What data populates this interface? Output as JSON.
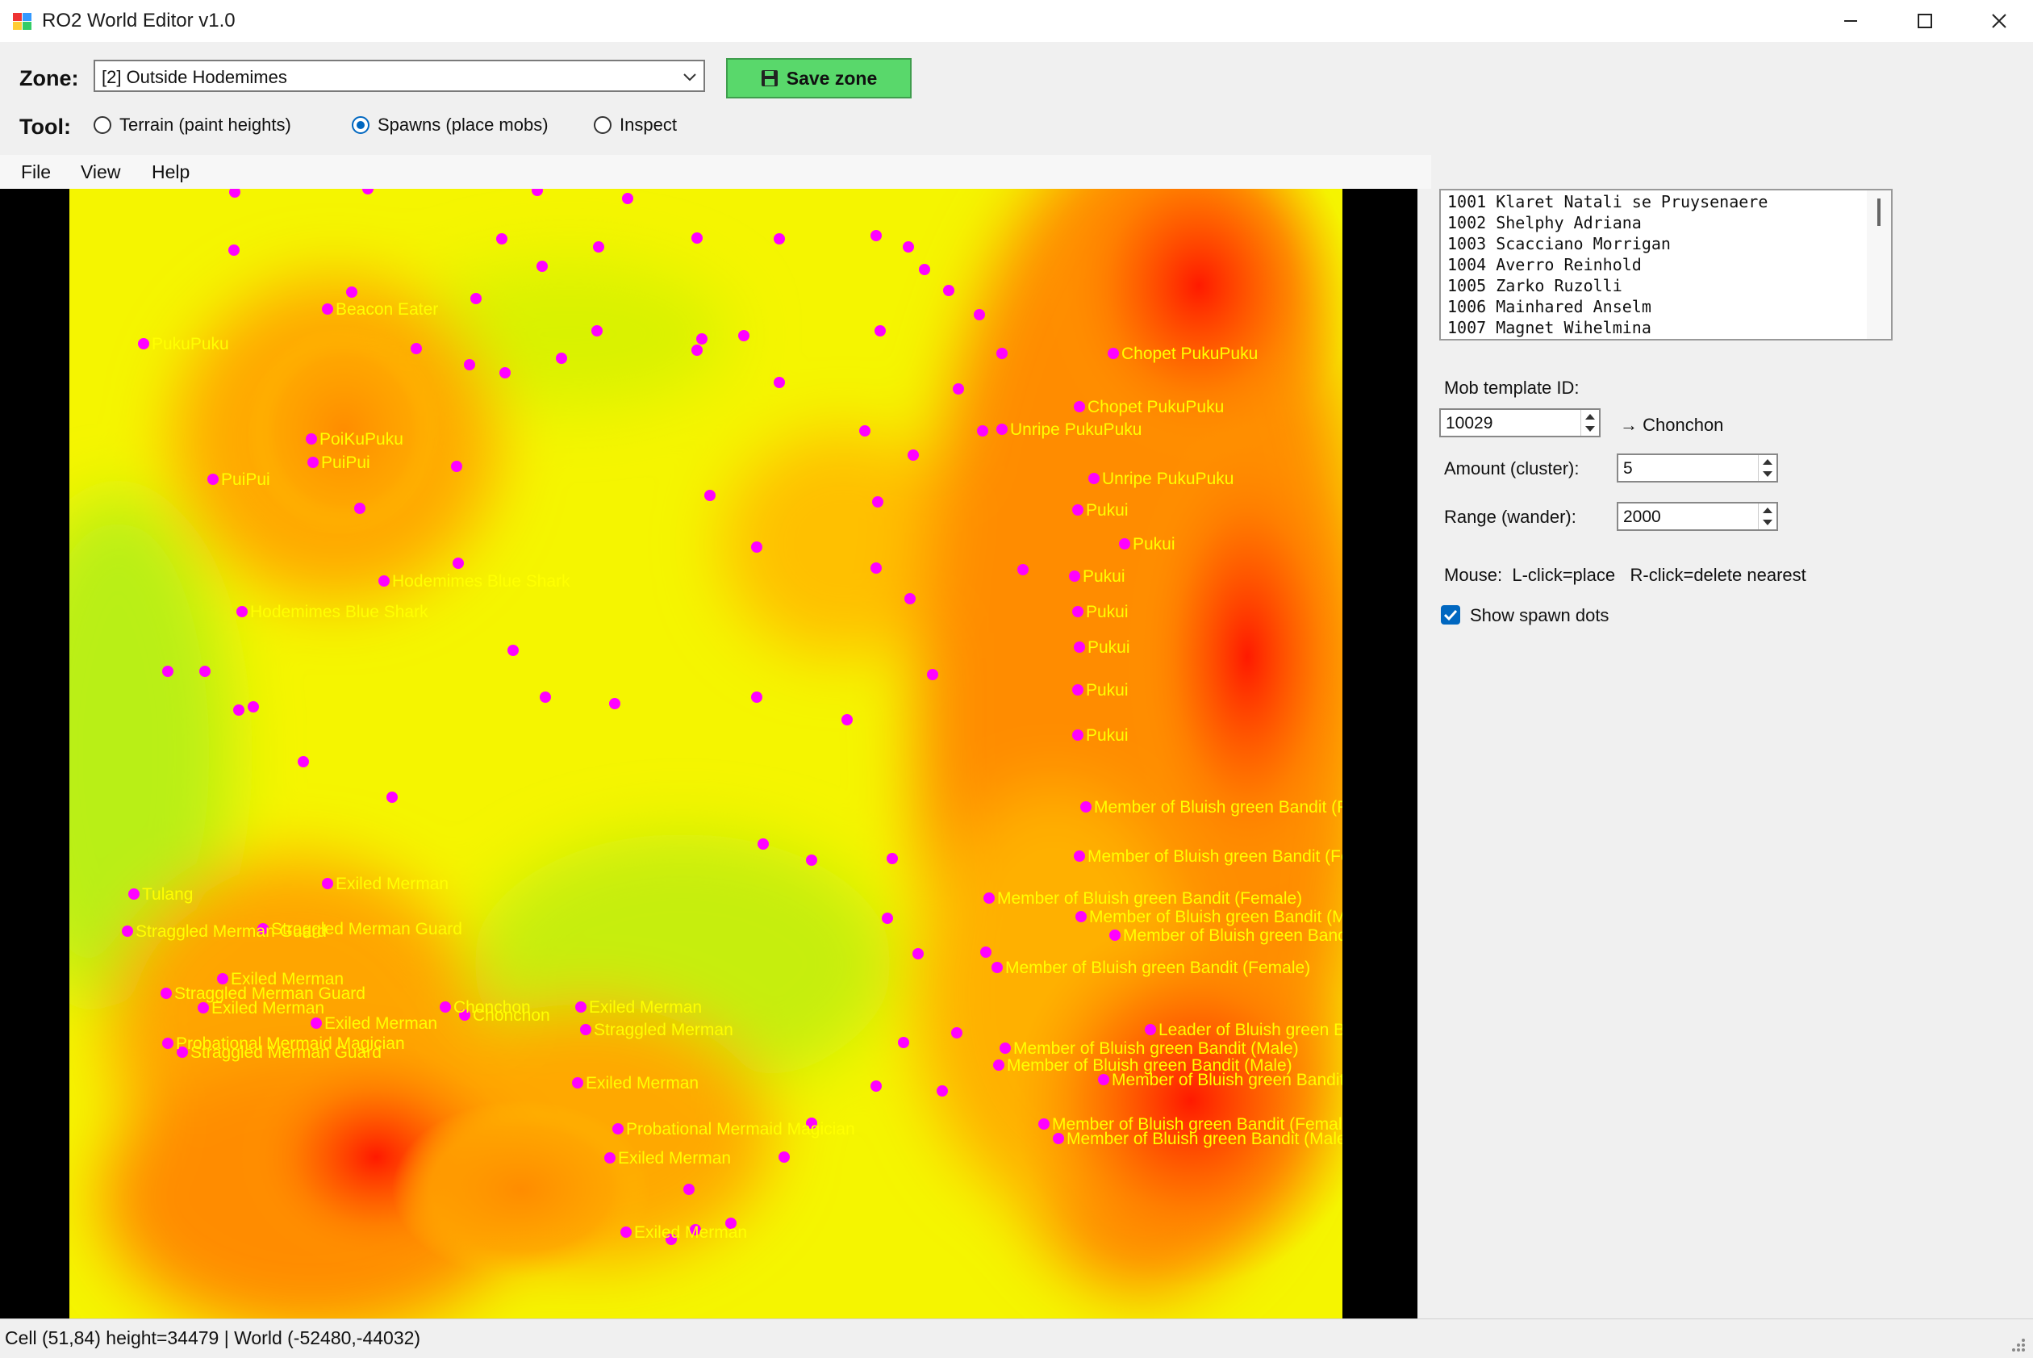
{
  "window": {
    "title": "RO2 World Editor v1.0",
    "icon": "app-icon"
  },
  "toolbar": {
    "zone_label": "Zone:",
    "zone_value": "[2] Outside Hodemimes",
    "save_label": "Save zone",
    "save_icon": "floppy-disk-icon",
    "tool_label": "Tool:",
    "tools": [
      {
        "label": "Terrain (paint heights)",
        "checked": false
      },
      {
        "label": "Spawns (place mobs)",
        "checked": true
      },
      {
        "label": "Inspect",
        "checked": false
      }
    ]
  },
  "menu": {
    "items": [
      "File",
      "View",
      "Help"
    ]
  },
  "map": {
    "dot_color": "#ff00ff",
    "label_color": "#ffff00",
    "labels": [
      {
        "t": "PukuPuku"
      },
      {
        "t": "Beacon Eater"
      },
      {
        "t": "PoiKuPuku"
      },
      {
        "t": "PuiPui"
      },
      {
        "t": "PuiPui"
      },
      {
        "t": "Hodemimes Blue Shark"
      },
      {
        "t": "Hodemimes Blue Shark"
      },
      {
        "t": "Chopet PukuPuku"
      },
      {
        "t": "Chopet PukuPuku"
      },
      {
        "t": "Unripe PukuPuku"
      },
      {
        "t": "Unripe PukuPuku"
      },
      {
        "t": "Pukui"
      },
      {
        "t": "Pukui"
      },
      {
        "t": "Pukui"
      },
      {
        "t": "Pukui"
      },
      {
        "t": "Pukui"
      },
      {
        "t": "Pukui"
      },
      {
        "t": "Pukui"
      },
      {
        "t": "Member of Bluish green Bandit (Female)"
      },
      {
        "t": "Member of Bluish green Bandit (Female)"
      },
      {
        "t": "Member of Bluish green Bandit (Female)"
      },
      {
        "t": "Member of Bluish green Bandit (Male)"
      },
      {
        "t": "Member of Bluish green Bandit (Male)"
      },
      {
        "t": "Member of Bluish green Bandit (Female)"
      },
      {
        "t": "Leader of Bluish green Bandit"
      },
      {
        "t": "Member of Bluish green Bandit (Male)"
      },
      {
        "t": "Member of Bluish green Bandit (Male)"
      },
      {
        "t": "Member of Bluish green Bandit (Female)"
      },
      {
        "t": "Member of Bluish green Bandit (Female)"
      },
      {
        "t": "Member of Bluish green Bandit (Male)"
      },
      {
        "t": "Tulang"
      },
      {
        "t": "Exiled Merman"
      },
      {
        "t": "Straggled Merman Guard"
      },
      {
        "t": "Straggled Merman Guard"
      },
      {
        "t": "Exiled Merman"
      },
      {
        "t": "Exiled Merman"
      },
      {
        "t": "Straggled Merman Guard"
      },
      {
        "t": "Exiled Merman"
      },
      {
        "t": "Chonchon"
      },
      {
        "t": "Chonchon"
      },
      {
        "t": "Probational Mermaid Magician"
      },
      {
        "t": "Straggled Merman Guard"
      },
      {
        "t": "Exiled Merman"
      },
      {
        "t": "Straggled Merman"
      },
      {
        "t": "Exiled Merman"
      },
      {
        "t": "Probational Mermaid Magician"
      },
      {
        "t": "Exiled Merman"
      },
      {
        "t": "Exiled Merman"
      }
    ]
  },
  "panel": {
    "mob_list": [
      "1001 Klaret Natali se Pruysenaere",
      "1002 Shelphy Adriana",
      "1003 Scacciano Morrigan",
      "1004 Averro Reinhold",
      "1005 Zarko Ruzolli",
      "1006 Mainhared Anselm",
      "1007 Magnet Wihelmina"
    ],
    "template_label": "Mob template ID:",
    "template_value": "10029",
    "template_resolved": "→ Chonchon",
    "amount_label": "Amount (cluster):",
    "amount_value": "5",
    "range_label": "Range (wander):",
    "range_value": "2000",
    "mouse_help": "Mouse:  L-click=place   R-click=delete nearest",
    "show_dots_label": "Show spawn dots",
    "show_dots_checked": true
  },
  "status": {
    "text": "Cell (51,84) height=34479 | World (-52480,-44032)"
  }
}
